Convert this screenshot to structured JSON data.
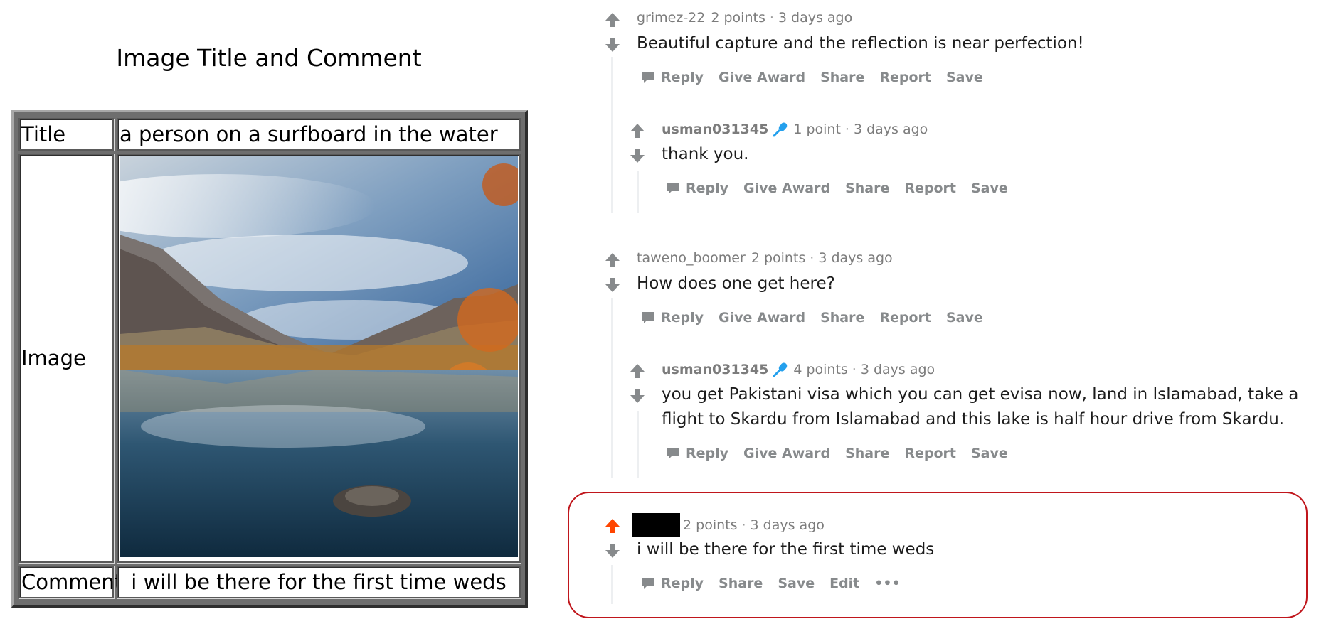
{
  "left_panel": {
    "heading": "Image Title and Comment",
    "rows": {
      "title_label": "Title",
      "title_value": "a person on a surfboard in the water",
      "image_label": "Image",
      "comment_label": "Comment",
      "comment_value": "i will be there for the first time weds"
    }
  },
  "thread": {
    "actions": {
      "reply": "Reply",
      "give_award": "Give Award",
      "share": "Share",
      "report": "Report",
      "save": "Save",
      "edit": "Edit",
      "more": "•••"
    },
    "separator": "·",
    "comments": [
      {
        "author": "grimez-22",
        "points": "2 points",
        "time": "3 days ago",
        "body": "Beautiful capture and the reflection is near perfection!"
      },
      {
        "author": "usman031345",
        "points": "1 point",
        "time": "3 days ago",
        "body": "thank you."
      },
      {
        "author": "taweno_boomer",
        "points": "2 points",
        "time": "3 days ago",
        "body": "How does one get here?"
      },
      {
        "author": "usman031345",
        "points": "4 points",
        "time": "3 days ago",
        "body": "you get Pakistani visa which you can get evisa now, land in Islamabad, take a flight to Skardu from Islamabad and this lake is half hour drive from Skardu."
      },
      {
        "author": "",
        "points": "2 points",
        "time": "3 days ago",
        "body": "i will be there for the first time weds"
      }
    ]
  },
  "colors": {
    "upvoted_arrow": "#ff4500",
    "vote_arrow": "#878a8c",
    "mic_icon": "#24a0ed",
    "highlight_border": "#c0161c"
  },
  "icons": {
    "upvote": "arrow-up-icon",
    "downvote": "arrow-down-icon",
    "reply": "speech-bubble-icon",
    "flair": "microphone-icon",
    "photo": "mountain-lake-photo"
  }
}
